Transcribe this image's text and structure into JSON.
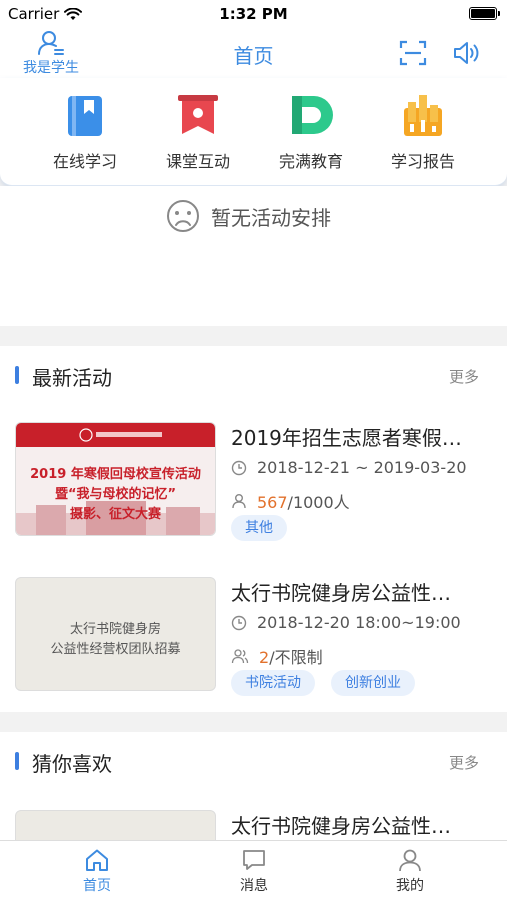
{
  "status_bar": {
    "carrier": "Carrier",
    "time": "1:32 PM"
  },
  "nav": {
    "left_label": "我是学生",
    "title": "首页"
  },
  "menu": [
    {
      "label": "在线学习",
      "icon": "book-icon",
      "color": "#3b8fe8"
    },
    {
      "label": "课堂互动",
      "icon": "banner-icon",
      "color": "#e8474f"
    },
    {
      "label": "完满教育",
      "icon": "d-logo-icon",
      "color": "#2dc98c"
    },
    {
      "label": "学习报告",
      "icon": "report-icon",
      "color": "#f5a623"
    }
  ],
  "schedule": {
    "empty_text": "暂无活动安排"
  },
  "latest": {
    "title": "最新活动",
    "more": "更多",
    "items": [
      {
        "title": "2019年招生志愿者寒假…",
        "time": "2018-12-21 ~ 2019-03-20",
        "count_highlight": "567",
        "count_rest": "/1000人",
        "tags": [
          "其他"
        ],
        "poster": {
          "line1": "2019 年寒假回母校宣传活动",
          "line2": "暨“我与母校的记忆”",
          "line3": "摄影、征文大赛"
        }
      },
      {
        "title": "太行书院健身房公益性…",
        "time": "2018-12-20  18:00~19:00",
        "count_highlight": "2",
        "count_rest": "/不限制",
        "tags": [
          "书院活动",
          "创新创业"
        ],
        "poster": {
          "line1": "太行书院健身房",
          "line2": "公益性经营权团队招募"
        }
      }
    ]
  },
  "guess": {
    "title": "猜你喜欢",
    "more": "更多",
    "items": [
      {
        "title": "太行书院健身房公益性…"
      }
    ]
  },
  "tabs": [
    {
      "label": "首页",
      "icon": "home-icon",
      "active": true
    },
    {
      "label": "消息",
      "icon": "message-icon",
      "active": false
    },
    {
      "label": "我的",
      "icon": "profile-icon",
      "active": false
    }
  ],
  "colors": {
    "accent": "#3d8be0",
    "highlight": "#e2712c",
    "tag_bg": "#e9f1fc"
  }
}
